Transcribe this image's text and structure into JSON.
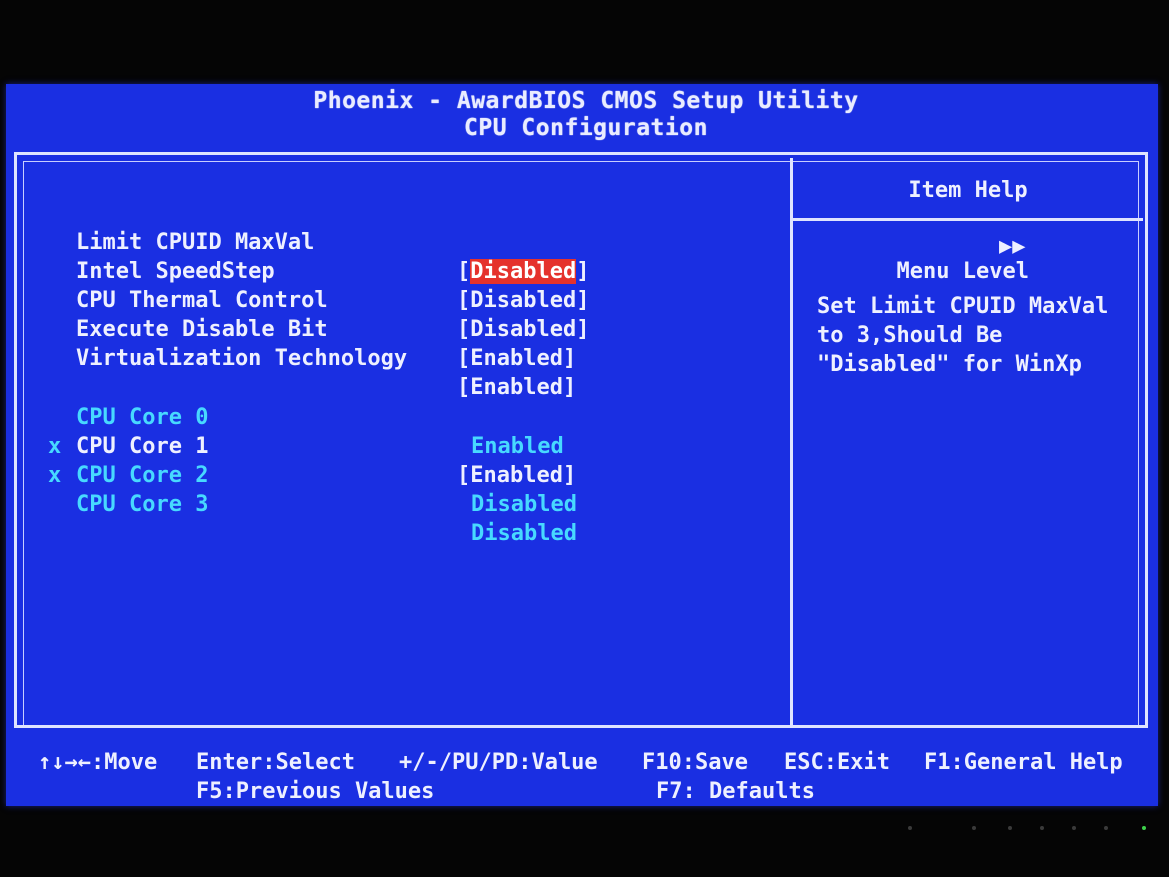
{
  "header": {
    "title": "Phoenix - AwardBIOS CMOS Setup Utility",
    "subtitle": "CPU Configuration"
  },
  "settings": [
    {
      "label": "Limit CPUID MaxVal",
      "value": "Disabled",
      "bracketed": true,
      "selected": true,
      "disabled_mark": false,
      "greyed": false
    },
    {
      "label": "Intel SpeedStep",
      "value": "Disabled",
      "bracketed": true,
      "selected": false,
      "disabled_mark": false,
      "greyed": false
    },
    {
      "label": "CPU Thermal Control",
      "value": "Disabled",
      "bracketed": true,
      "selected": false,
      "disabled_mark": false,
      "greyed": false
    },
    {
      "label": "Execute Disable Bit",
      "value": "Enabled",
      "bracketed": true,
      "selected": false,
      "disabled_mark": false,
      "greyed": false
    },
    {
      "label": "Virtualization Technology",
      "value": "Enabled",
      "bracketed": true,
      "selected": false,
      "disabled_mark": false,
      "greyed": false
    },
    {
      "label": "CPU Core 0",
      "value": "Enabled",
      "bracketed": false,
      "selected": false,
      "disabled_mark": false,
      "greyed": true
    },
    {
      "label": "CPU Core 1",
      "value": "Enabled",
      "bracketed": true,
      "selected": false,
      "disabled_mark": false,
      "greyed": false
    },
    {
      "label": "CPU Core 2",
      "value": "Disabled",
      "bracketed": false,
      "selected": false,
      "disabled_mark": true,
      "greyed": true
    },
    {
      "label": "CPU Core 3",
      "value": "Disabled",
      "bracketed": false,
      "selected": false,
      "disabled_mark": true,
      "greyed": true
    }
  ],
  "disabled_mark_char": "x",
  "help": {
    "title": "Item Help",
    "menu_level_label": "Menu Level",
    "menu_level_arrows": "▶▶",
    "text_lines": [
      "Set Limit CPUID MaxVal",
      "to 3,Should Be",
      "\"Disabled\" for WinXp"
    ]
  },
  "footer": {
    "move": "↑↓→←:Move",
    "enter": "Enter:Select",
    "value": "+/-/PU/PD:Value",
    "save": "F10:Save",
    "exit": "ESC:Exit",
    "help": "F1:General Help",
    "previous": "F5:Previous Values",
    "defaults": "F7: Defaults"
  },
  "colors": {
    "background": "#1a2fe2",
    "text": "#eef0ff",
    "greyed_text": "#47d9ff",
    "selection": "#e5322c"
  }
}
